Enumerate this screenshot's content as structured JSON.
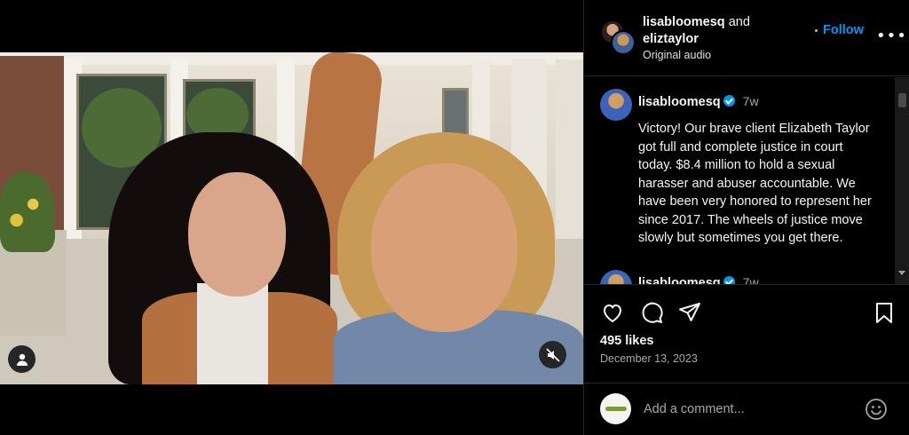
{
  "header": {
    "user1": "lisabloomesq",
    "joiner": "and",
    "user2": "eliztaylor",
    "audio": "Original audio",
    "follow_label": "Follow",
    "more_label": "•••"
  },
  "comments": [
    {
      "username": "lisabloomesq",
      "time": "7w",
      "verified": true,
      "text": "Victory! Our brave client Elizabeth Taylor got full and complete justice in court today. $8.4 million to hold a sexual harasser and abuser accountable. We have been very honored to represent her since 2017. The wheels of justice move slowly but sometimes you get there."
    },
    {
      "username": "lisabloomesq",
      "time": "7w",
      "verified": true,
      "text": ""
    }
  ],
  "actions": {
    "like_icon": "heart-icon",
    "comment_icon": "comment-icon",
    "share_icon": "share-icon",
    "save_icon": "bookmark-icon"
  },
  "likes": "495 likes",
  "date": "December 13, 2023",
  "add_comment": {
    "placeholder": "Add a comment...",
    "emoji_icon": "emoji-icon"
  },
  "colors": {
    "accent": "#0095f6",
    "background": "#000000",
    "divider": "#262626",
    "muted_text": "#a8a8a8"
  }
}
